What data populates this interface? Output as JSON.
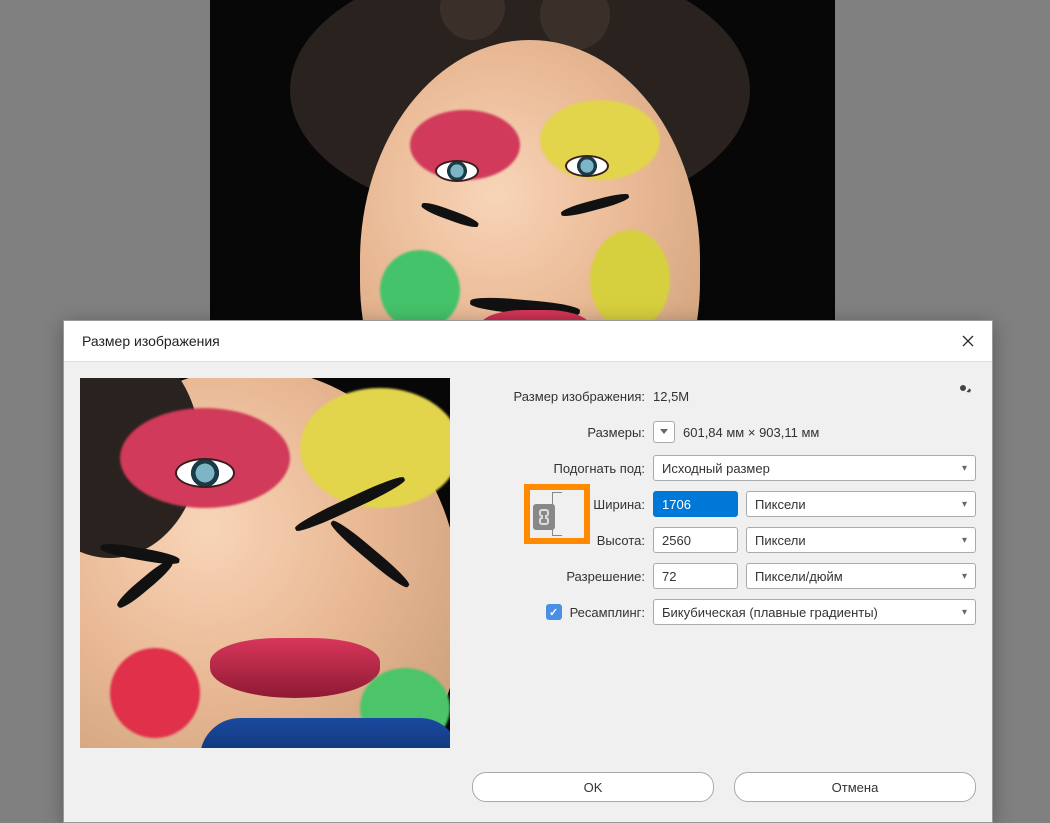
{
  "dialog": {
    "title": "Размер изображения",
    "size_label": "Размер изображения:",
    "size_value": "12,5M",
    "dims_label": "Размеры:",
    "dims_value": "601,84 мм  ×  903,11 мм",
    "fit_label": "Подогнать под:",
    "fit_value": "Исходный размер",
    "width_label": "Ширина:",
    "width_value": "1706",
    "width_unit": "Пиксели",
    "height_label": "Высота:",
    "height_value": "2560",
    "height_unit": "Пиксели",
    "res_label": "Разрешение:",
    "res_value": "72",
    "res_unit": "Пиксели/дюйм",
    "resample_label": "Ресамплинг:",
    "resample_value": "Бикубическая (плавные градиенты)",
    "ok": "OK",
    "cancel": "Отмена"
  }
}
